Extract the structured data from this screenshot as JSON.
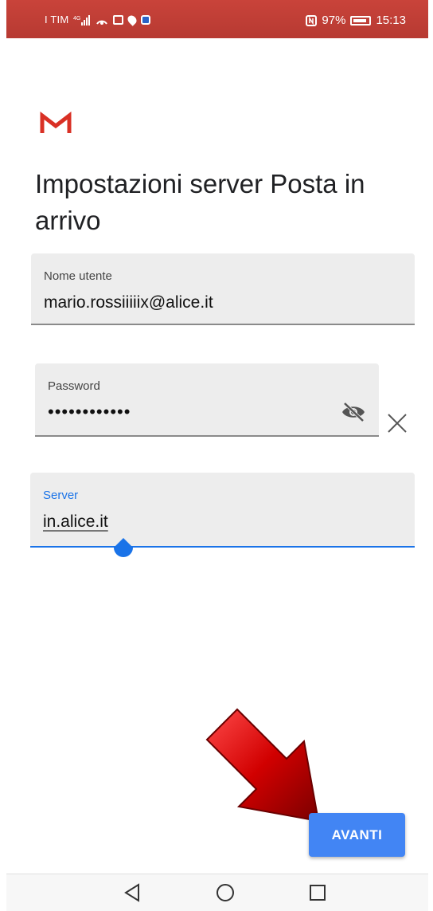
{
  "status_bar": {
    "carrier": "I TIM",
    "network": "4G",
    "battery": "97%",
    "time": "15:13",
    "icons": [
      "signal-icon",
      "hotspot-icon",
      "screenshot-icon",
      "location-icon",
      "app-notification-icon",
      "nfc-icon",
      "battery-icon"
    ]
  },
  "header": {
    "logo": "gmail-icon",
    "title": "Impostazioni server Posta in arrivo"
  },
  "form": {
    "username": {
      "label": "Nome utente",
      "value": "mario.rossiiiiix@alice.it"
    },
    "password": {
      "label": "Password",
      "value": "••••••••••••",
      "toggle_icon": "visibility-off-icon",
      "clear_icon": "close-icon"
    },
    "server": {
      "label": "Server",
      "value": "in.alice.it"
    }
  },
  "actions": {
    "next_label": "AVANTI"
  },
  "nav_bar": {
    "icons": [
      "back-icon",
      "home-icon",
      "recent-apps-icon"
    ]
  },
  "colors": {
    "status_bar": "#c9433a",
    "accent": "#1a73e8",
    "button": "#4285f4",
    "arrow": "#cc0000"
  }
}
